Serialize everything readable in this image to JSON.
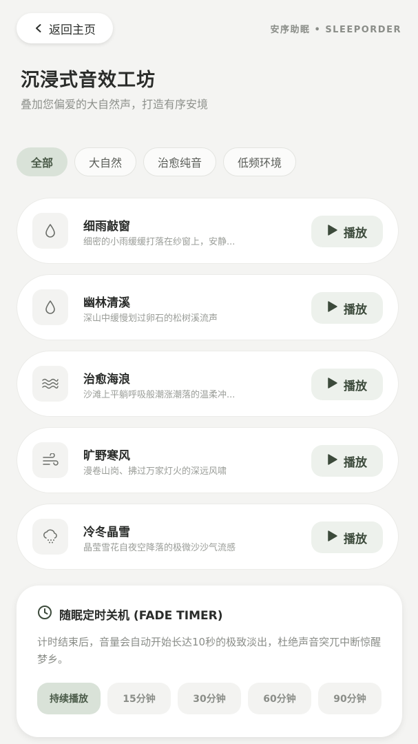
{
  "header": {
    "back_label": "返回主页",
    "brand": "安序助眠 • SLEEPORDER",
    "title": "沉浸式音效工坊",
    "subtitle": "叠加您偏爱的大自然声，打造有序安境"
  },
  "filters": [
    {
      "label": "全部",
      "active": true
    },
    {
      "label": "大自然",
      "active": false
    },
    {
      "label": "治愈纯音",
      "active": false
    },
    {
      "label": "低频环境",
      "active": false
    }
  ],
  "sounds": [
    {
      "name": "细雨敲窗",
      "desc": "细密的小雨缓缓打落在纱窗上，安静...",
      "icon": "droplet-icon",
      "play_label": "播放"
    },
    {
      "name": "幽林清溪",
      "desc": "深山中缓慢划过卵石的松树溪流声",
      "icon": "droplet-icon",
      "play_label": "播放"
    },
    {
      "name": "治愈海浪",
      "desc": "沙滩上平躺呼吸般潮涨潮落的温柔冲...",
      "icon": "waves-icon",
      "play_label": "播放"
    },
    {
      "name": "旷野寒风",
      "desc": "漫卷山岗、拂过万家灯火的深远风啸",
      "icon": "wind-icon",
      "play_label": "播放"
    },
    {
      "name": "冷冬晶雪",
      "desc": "晶莹雪花自夜空降落的极微沙沙气流感",
      "icon": "cloud-snow-icon",
      "play_label": "播放"
    }
  ],
  "timer": {
    "title": "随眠定时关机 (FADE TIMER)",
    "description": "计时结束后，音量会自动开始长达10秒的极致淡出，杜绝声音突兀中断惊醒梦乡。",
    "options": [
      {
        "label": "持续播放",
        "active": true
      },
      {
        "label": "15分钟",
        "active": false
      },
      {
        "label": "30分钟",
        "active": false
      },
      {
        "label": "60分钟",
        "active": false
      },
      {
        "label": "90分钟",
        "active": false
      }
    ]
  },
  "colors": {
    "background": "#f4f4f2",
    "accent_soft": "#d9e2d8",
    "play_bg": "#edf1ec",
    "play_fg": "#3c4a3b"
  }
}
